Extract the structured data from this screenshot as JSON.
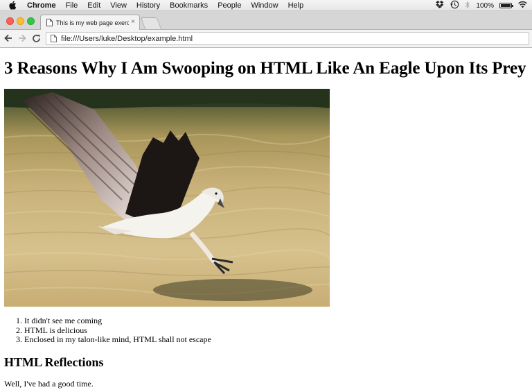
{
  "menubar": {
    "app_name": "Chrome",
    "items": [
      "File",
      "Edit",
      "View",
      "History",
      "Bookmarks",
      "People",
      "Window",
      "Help"
    ],
    "battery_text": "100%",
    "battery_level": 1.0
  },
  "tab": {
    "title": "This is my web page exerc",
    "close_label": "×"
  },
  "address_bar": {
    "url": "file:///Users/luke/Desktop/example.html"
  },
  "page": {
    "heading": "3 Reasons Why I Am Swooping on HTML Like An Eagle Upon Its Prey",
    "reasons": [
      "It didn't see me coming",
      "HTML is delicious",
      "Enclosed in my talon-like mind, HTML shall not escape"
    ],
    "subheading": "HTML Reflections",
    "paragraph": "Well, I've had a good time."
  },
  "colors": {
    "close_red": "#fc5f57",
    "minimize_yellow": "#fdbc2e",
    "zoom_green": "#33c748"
  }
}
